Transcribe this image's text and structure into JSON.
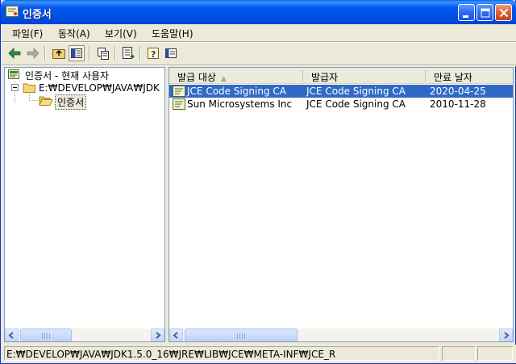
{
  "window": {
    "title": "인증서"
  },
  "menubar": {
    "items": [
      {
        "label": "파일(F)"
      },
      {
        "label": "동작(A)"
      },
      {
        "label": "보기(V)"
      },
      {
        "label": "도움말(H)"
      }
    ]
  },
  "toolbar": {
    "buttons": [
      "back-icon",
      "forward-icon",
      "up-folder-icon",
      "show-hide-tree-icon",
      "copy-icon",
      "export-list-icon",
      "help-icon",
      "properties-icon"
    ]
  },
  "tree": {
    "root": {
      "label": "인증서 - 현재 사용자"
    },
    "child": {
      "label": "E:₩DEVELOP₩JAVA₩JDK"
    },
    "grandchild": {
      "label": "인증서"
    }
  },
  "list": {
    "columns": [
      {
        "label": "발급 대상"
      },
      {
        "label": "발급자"
      },
      {
        "label": "만료 날자"
      }
    ],
    "rows": [
      {
        "issued_to": "JCE Code Signing CA",
        "issued_by": "JCE Code Signing CA",
        "expires": "2020-04-25",
        "selected": true
      },
      {
        "issued_to": "Sun Microsystems Inc",
        "issued_by": "JCE Code Signing CA",
        "expires": "2010-11-28",
        "selected": false
      }
    ]
  },
  "statusbar": {
    "text": "E:₩DEVELOP₩JAVA₩JDK1.5.0_16₩JRE₩LIB₩JCE₩META-INF₩JCE_R"
  },
  "colors": {
    "titlebar": "#0054e3",
    "selection": "#316ac5",
    "window_bg": "#ece9d8",
    "close_button": "#e0603a"
  }
}
